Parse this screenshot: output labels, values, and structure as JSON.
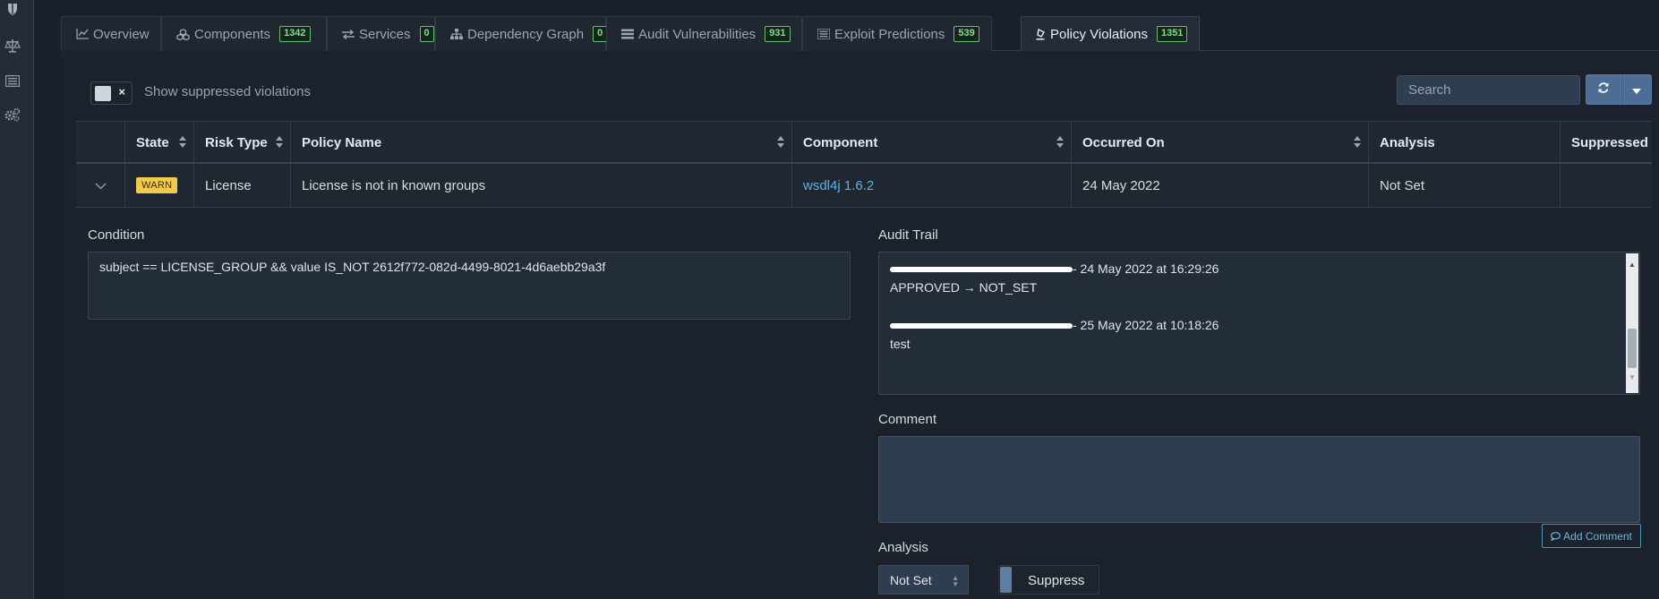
{
  "tabs": [
    {
      "label": "Overview",
      "icon": "line-chart-icon",
      "badge": null
    },
    {
      "label": "Components",
      "icon": "cubes-icon",
      "badge": "1342"
    },
    {
      "label": "Services",
      "icon": "exchange-icon",
      "badge": "0"
    },
    {
      "label": "Dependency Graph",
      "icon": "sitemap-icon",
      "badge": "0"
    },
    {
      "label": "Audit Vulnerabilities",
      "icon": "tasks-icon",
      "badge": "931"
    },
    {
      "label": "Exploit Predictions",
      "icon": "list-icon",
      "badge": "539"
    },
    {
      "label": "Policy Violations",
      "icon": "fire-icon",
      "badge": "1351"
    }
  ],
  "toolbar": {
    "suppressed_label": "Show suppressed violations",
    "toggle_glyph": "×",
    "search_placeholder": "Search"
  },
  "table": {
    "headers": [
      "State",
      "Risk Type",
      "Policy Name",
      "Component",
      "Occurred On",
      "Analysis",
      "Suppressed"
    ],
    "row": {
      "state": "WARN",
      "risk_type": "License",
      "policy_name": "License is not in known groups",
      "component": "wsdl4j 1.6.2",
      "occurred_on": "24 May 2022",
      "analysis": "Not Set",
      "suppressed": ""
    }
  },
  "details": {
    "condition_label": "Condition",
    "condition_text": "subject == LICENSE_GROUP && value IS_NOT 2612f772-082d-4499-8021-4d6aebb29a3f",
    "audit_label": "Audit Trail",
    "audit_entries": [
      {
        "meta": "- 24 May 2022 at 16:29:26",
        "text": "APPROVED → NOT_SET"
      },
      {
        "meta": "- 25 May 2022 at 10:18:26",
        "text": "test"
      }
    ],
    "comment_label": "Comment",
    "add_comment_label": "Add Comment",
    "analysis_label": "Analysis",
    "analysis_value": "Not Set",
    "suppress_label": "Suppress"
  },
  "colors": {
    "background": "#1a212b",
    "accent": "#4d6d95",
    "link": "#5eb1e7",
    "warn": "#f2c94c",
    "badge": "#7de08a"
  }
}
